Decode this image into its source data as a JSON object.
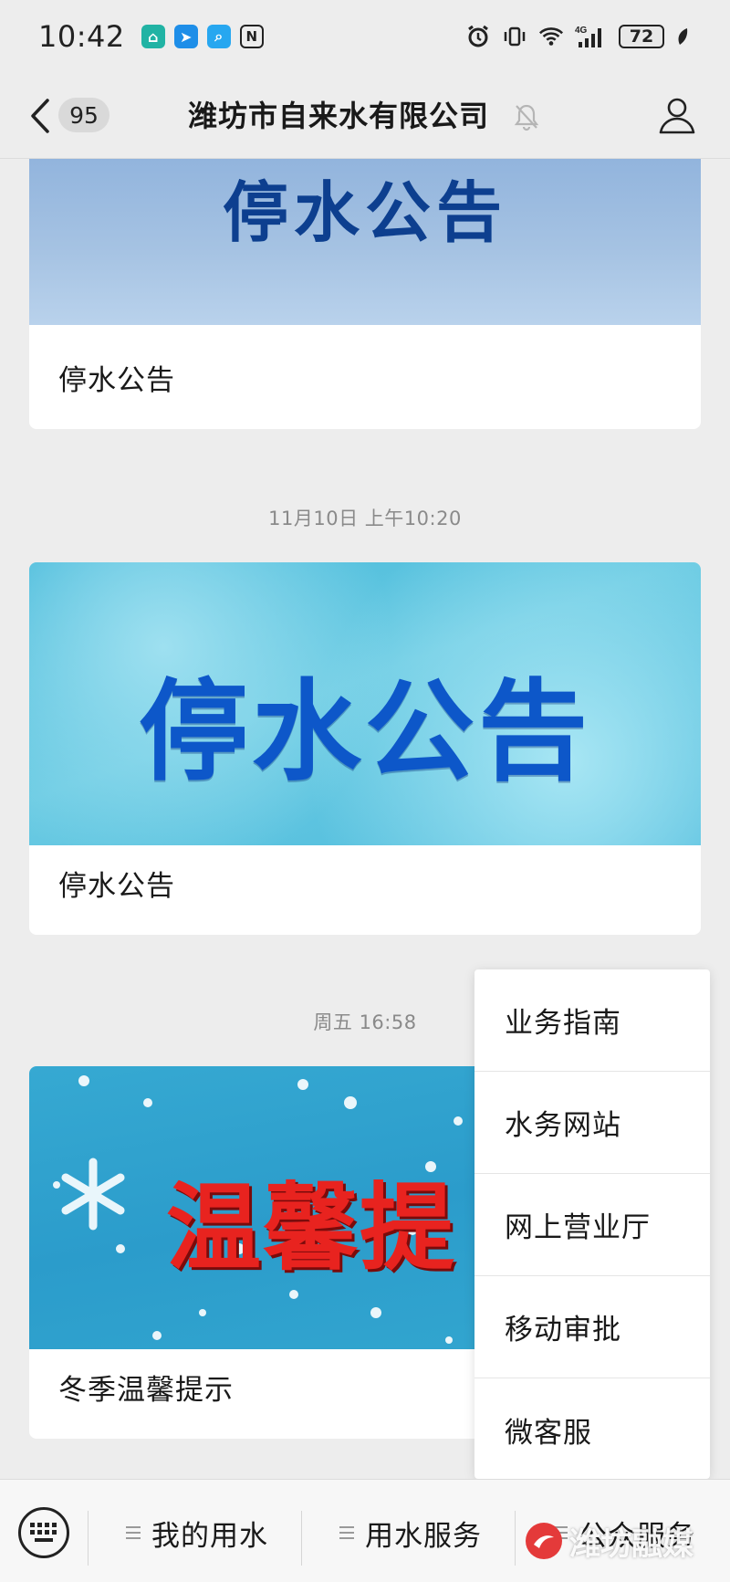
{
  "status_bar": {
    "time": "10:42",
    "battery": "72",
    "network": "4G",
    "icons": [
      "home-app-icon",
      "send-app-icon",
      "search-app-icon",
      "nfc-icon",
      "alarm-icon",
      "vibrate-icon",
      "wifi-icon",
      "signal-icon",
      "battery-icon",
      "leaf-icon"
    ]
  },
  "header": {
    "back_badge": "95",
    "title": "潍坊市自来水有限公司",
    "mute_icon": "bell-off-icon",
    "profile_icon": "person-icon"
  },
  "messages": [
    {
      "cover_text": "停水公告",
      "title": "停水公告"
    },
    {
      "timestamp": "11月10日 上午10:20",
      "cover_text": "停水公告",
      "title": "停水公告"
    },
    {
      "timestamp": "周五 16:58",
      "cover_text": "温馨提",
      "title": "冬季温馨提示"
    }
  ],
  "popup_menu": {
    "items": [
      "业务指南",
      "水务网站",
      "网上营业厅",
      "移动审批",
      "微客服"
    ]
  },
  "bottom_menu": {
    "keyboard_icon": "keyboard-icon",
    "tabs": [
      "我的用水",
      "用水服务",
      "公众服务"
    ]
  },
  "watermark": {
    "text": "潍坊融媒"
  },
  "colors": {
    "background": "#ededed",
    "card": "#ffffff",
    "cover1_top": "#8fb2dc",
    "cover2": "#5cc0dc",
    "cover3": "#2fa6cf",
    "cover_text_blue": "#0d3f8f",
    "cover_text_red": "#e8231f"
  }
}
